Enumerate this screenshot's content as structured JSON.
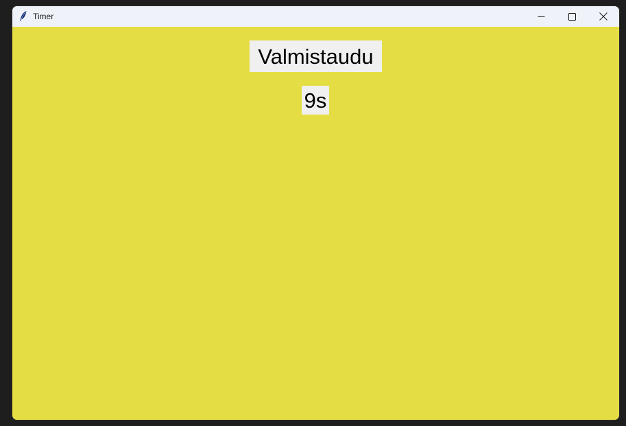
{
  "window": {
    "title": "Timer",
    "icon": "feather-icon",
    "controls": {
      "minimize": "minimize-icon",
      "maximize": "maximize-icon",
      "close": "close-icon"
    }
  },
  "main": {
    "status_text": "Valmistaudu",
    "countdown_text": "9s"
  },
  "colors": {
    "background": "#e5dd44",
    "label_background": "#f0f0f0",
    "titlebar": "#eff3f9"
  }
}
